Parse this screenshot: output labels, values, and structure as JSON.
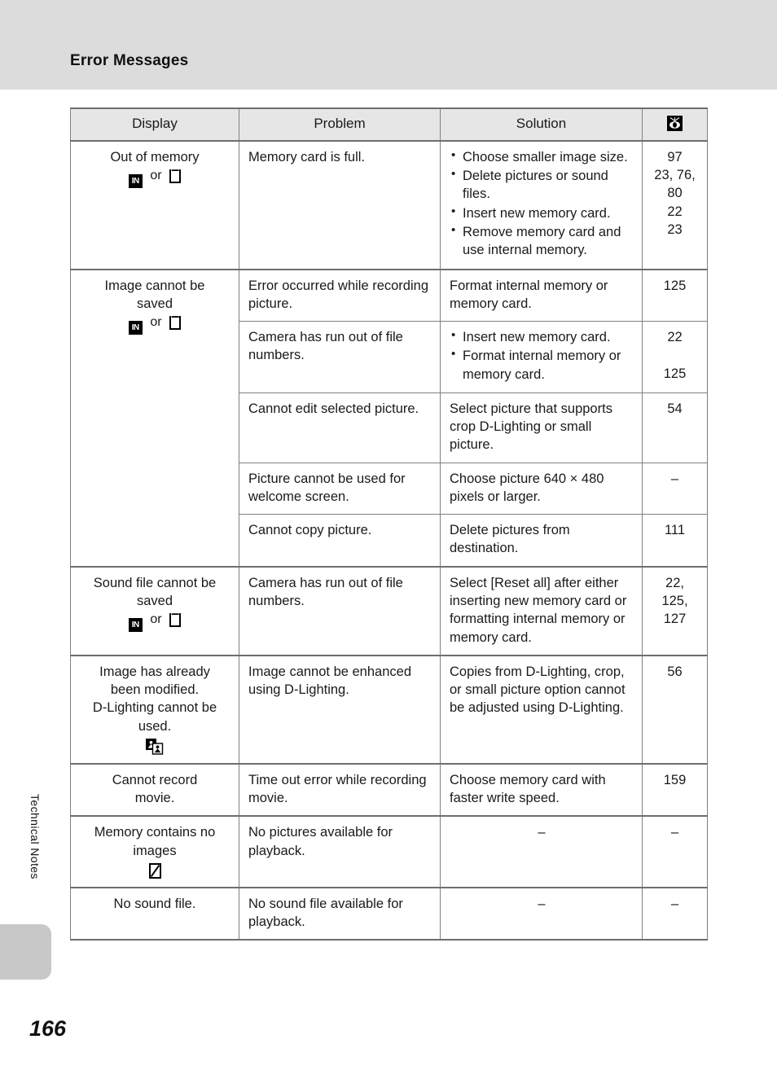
{
  "header": {
    "section_title": "Error Messages"
  },
  "side": {
    "chapter_label": "Technical Notes"
  },
  "page": {
    "number": "166"
  },
  "table": {
    "columns": [
      {
        "key": "display",
        "label": "Display"
      },
      {
        "key": "problem",
        "label": "Problem"
      },
      {
        "key": "solution",
        "label": "Solution"
      },
      {
        "key": "ref",
        "label": "",
        "icon": "book-reference-icon"
      }
    ],
    "rows": [
      {
        "display": {
          "lines": [
            "Out of memory"
          ],
          "icons": [
            "internal-memory-icon",
            "memory-card-icon"
          ],
          "icon_sep": "or",
          "rowspan": 1
        },
        "problem": "Memory card is full.",
        "solution_bullets": [
          "Choose smaller image size.",
          "Delete pictures or sound files.",
          "Insert new memory card.",
          "Remove memory card and use internal memory."
        ],
        "ref_lines": [
          "97",
          "23, 76,",
          "80",
          "22",
          "23"
        ]
      },
      {
        "display": {
          "lines": [
            "Image cannot be",
            "saved"
          ],
          "icons": [
            "internal-memory-icon",
            "memory-card-icon"
          ],
          "icon_sep": "or",
          "rowspan": 5
        },
        "problem": "Error occurred while recording picture.",
        "solution": "Format internal memory or memory card.",
        "ref_lines": [
          "125"
        ]
      },
      {
        "problem": "Camera has run out of file numbers.",
        "solution_bullets": [
          "Insert new memory card.",
          "Format internal memory or memory card."
        ],
        "ref_lines": [
          "22",
          "",
          "125"
        ]
      },
      {
        "problem": "Cannot edit selected picture.",
        "solution": "Select picture that supports crop D-Lighting or small picture.",
        "ref_lines": [
          "54"
        ]
      },
      {
        "problem": "Picture cannot be used for welcome screen.",
        "solution": "Choose picture 640 × 480 pixels or larger.",
        "ref_lines": [
          "–"
        ]
      },
      {
        "problem": "Cannot copy picture.",
        "solution": "Delete pictures from destination.",
        "ref_lines": [
          "111"
        ]
      },
      {
        "display": {
          "lines": [
            "Sound file cannot be",
            "saved"
          ],
          "icons": [
            "internal-memory-icon",
            "memory-card-icon"
          ],
          "icon_sep": "or",
          "rowspan": 1
        },
        "problem": "Camera has run out of file numbers.",
        "solution": "Select [Reset all] after either inserting new memory card or formatting internal memory or memory card.",
        "ref_lines": [
          "22,",
          "125,",
          "127"
        ]
      },
      {
        "display": {
          "lines": [
            "Image has already",
            "been modified.",
            "D-Lighting cannot be",
            "used."
          ],
          "icons": [
            "copy-pictures-icon"
          ],
          "rowspan": 1
        },
        "problem": "Image cannot be enhanced using D-Lighting.",
        "solution": "Copies from D-Lighting, crop, or small picture option cannot be adjusted using D-Lighting.",
        "ref_lines": [
          "56"
        ]
      },
      {
        "display": {
          "lines": [
            "Cannot record",
            "movie."
          ],
          "icons": [],
          "rowspan": 1
        },
        "problem": "Time out error while recording movie.",
        "solution": "Choose memory card with faster write speed.",
        "ref_lines": [
          "159"
        ]
      },
      {
        "display": {
          "lines": [
            "Memory contains no",
            "images"
          ],
          "icons": [
            "no-images-icon"
          ],
          "rowspan": 1
        },
        "problem": "No pictures available for playback.",
        "solution": "–",
        "ref_lines": [
          "–"
        ]
      },
      {
        "display": {
          "lines": [
            "No sound file."
          ],
          "icons": [],
          "rowspan": 1
        },
        "problem": "No sound file available for playback.",
        "solution": "–",
        "ref_lines": [
          "–"
        ]
      }
    ]
  },
  "colors": {
    "header_band": "#dcdcdc",
    "table_header_fill": "#e6e6e6",
    "rule": "#6e6e6e",
    "side_tab": "#c8c8c8",
    "text": "#1a1a1a"
  }
}
